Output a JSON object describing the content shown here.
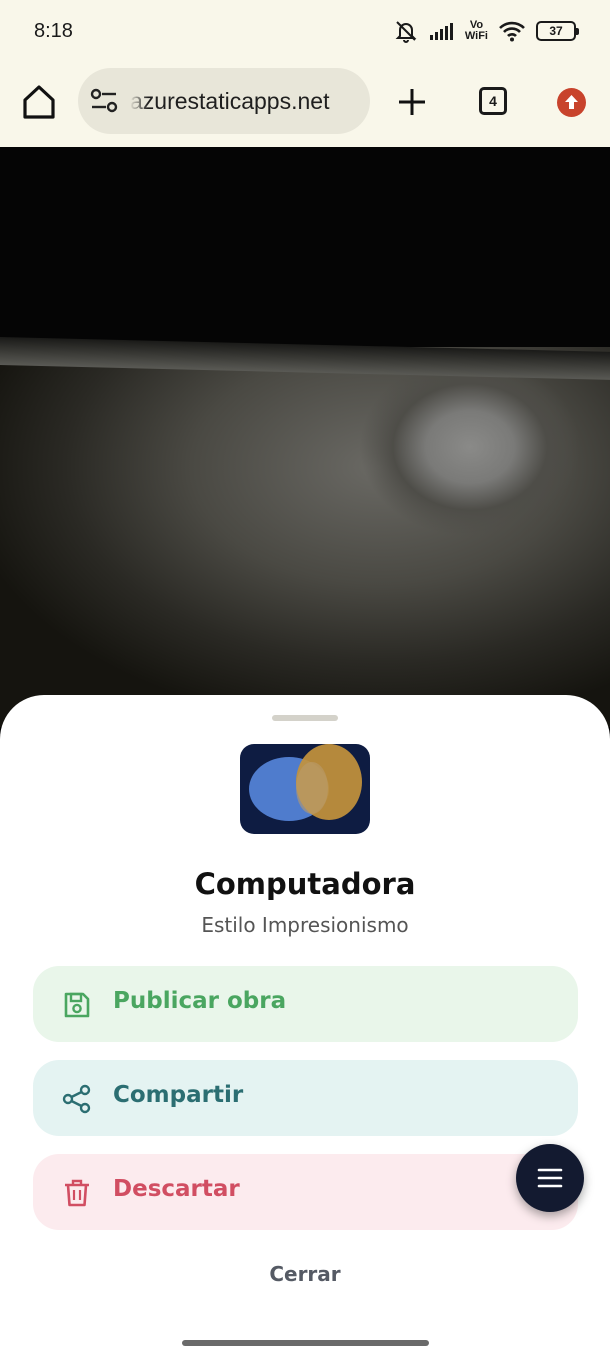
{
  "status_bar": {
    "time": "8:18",
    "network_label_top": "Vo",
    "network_label_bottom": "WiFi",
    "battery": "37"
  },
  "browser": {
    "url": "azurestaticapps.net",
    "tab_count": "4"
  },
  "sheet": {
    "title": "Computadora",
    "subtitle": "Estilo Impresionismo",
    "actions": [
      {
        "label": "Publicar obra",
        "icon": "save-icon",
        "color": "#4aa660"
      },
      {
        "label": "Compartir",
        "icon": "share-icon",
        "color": "#2b6e72"
      },
      {
        "label": "Descartar",
        "icon": "trash-icon",
        "color": "#d14e62"
      }
    ],
    "close_label": "Cerrar"
  },
  "fab": {
    "icon": "menu-icon"
  },
  "colors": {
    "chrome_bg": "#f9f7ea",
    "thumb_bg": "#0e1c42",
    "fab_bg": "#131a30"
  }
}
